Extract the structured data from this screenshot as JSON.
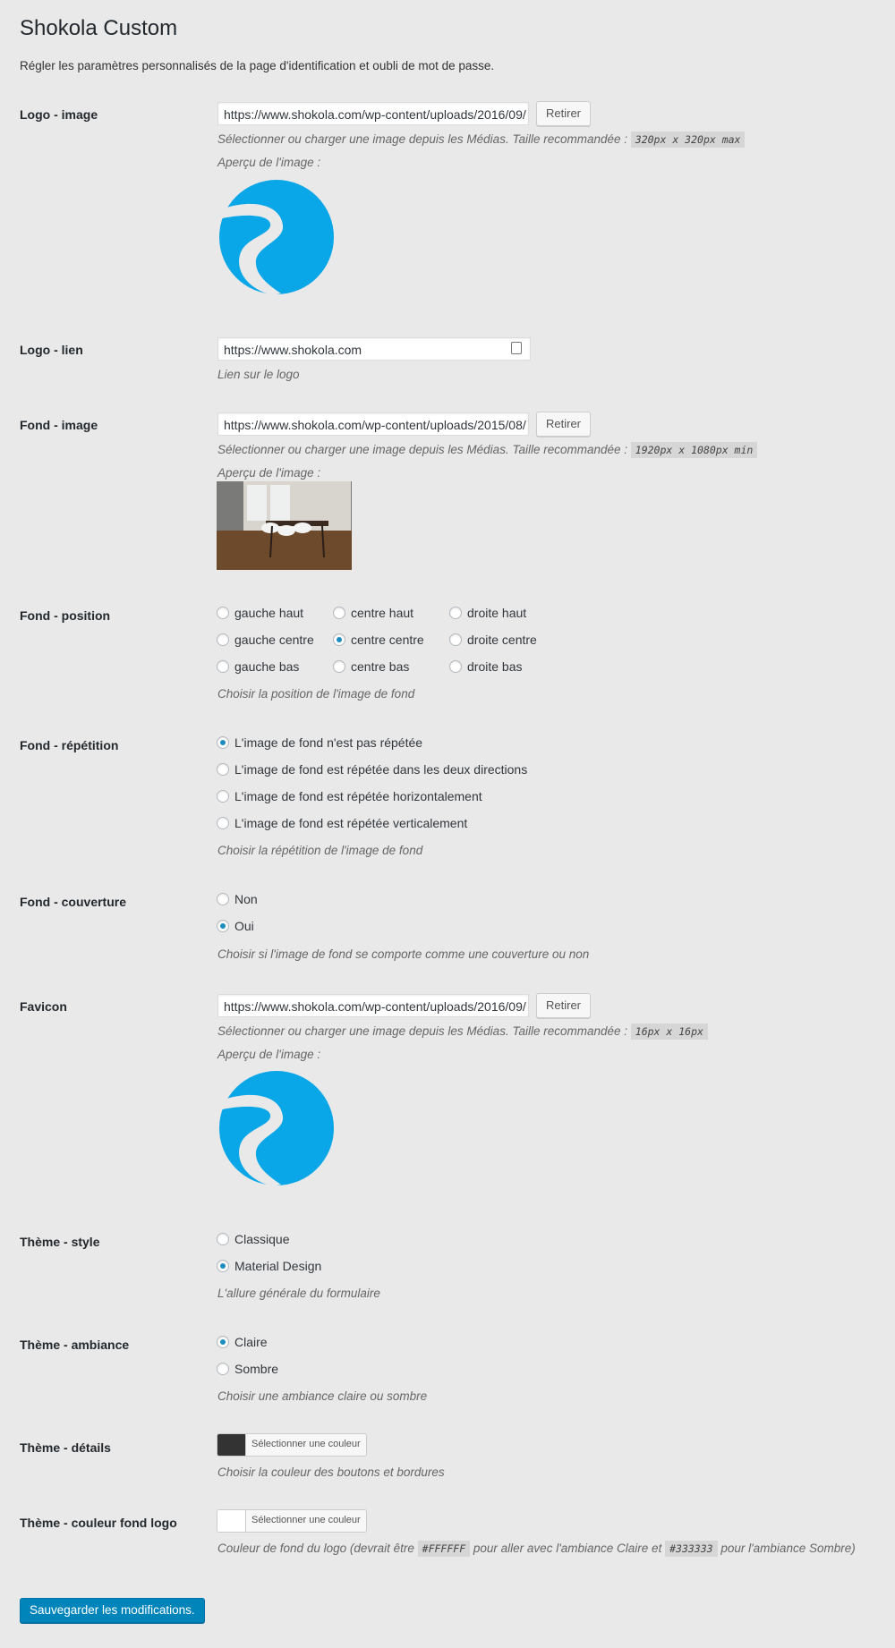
{
  "page": {
    "title": "Shokola Custom",
    "intro": "Régler les paramètres personnalisés de la page d'identification et oubli de mot de passe."
  },
  "preview_label": "Aperçu de l'image :",
  "remove_label": "Retirer",
  "media_desc": "Sélectionner ou charger une image depuis les Médias. Taille recommandée :",
  "logo_image": {
    "label": "Logo - image",
    "value": "https://www.shokola.com/wp-content/uploads/2016/09/",
    "size": "320px x 320px max"
  },
  "logo_link": {
    "label": "Logo - lien",
    "value": "https://www.shokola.com",
    "desc": "Lien sur le logo"
  },
  "bg_image": {
    "label": "Fond - image",
    "value": "https://www.shokola.com/wp-content/uploads/2015/08/",
    "size": "1920px x 1080px min"
  },
  "bg_position": {
    "label": "Fond - position",
    "options": [
      "gauche haut",
      "centre haut",
      "droite haut",
      "gauche centre",
      "centre centre",
      "droite centre",
      "gauche bas",
      "centre bas",
      "droite bas"
    ],
    "selected": "centre centre",
    "desc": "Choisir la position de l'image de fond"
  },
  "bg_repeat": {
    "label": "Fond - répétition",
    "options": [
      "L'image de fond n'est pas répétée",
      "L'image de fond est répétée dans les deux directions",
      "L'image de fond est répétée horizontalement",
      "L'image de fond est répétée verticalement"
    ],
    "selected": "L'image de fond n'est pas répétée",
    "desc": "Choisir la répétition de l'image de fond"
  },
  "bg_cover": {
    "label": "Fond - couverture",
    "options": [
      "Non",
      "Oui"
    ],
    "selected": "Oui",
    "desc": "Choisir si l'image de fond se comporte comme une couverture ou non"
  },
  "favicon": {
    "label": "Favicon",
    "value": "https://www.shokola.com/wp-content/uploads/2016/09/",
    "size": "16px x 16px"
  },
  "theme_style": {
    "label": "Thème - style",
    "options": [
      "Classique",
      "Material Design"
    ],
    "selected": "Material Design",
    "desc": "L'allure générale du formulaire"
  },
  "theme_mood": {
    "label": "Thème - ambiance",
    "options": [
      "Claire",
      "Sombre"
    ],
    "selected": "Claire",
    "desc": "Choisir une ambiance claire ou sombre"
  },
  "theme_details": {
    "label": "Thème - détails",
    "button": "Sélectionner une couleur",
    "color": "#333333",
    "desc": "Choisir la couleur des boutons et bordures"
  },
  "theme_logo_bg": {
    "label": "Thème - couleur fond logo",
    "button": "Sélectionner une couleur",
    "color": "#FFFFFF",
    "desc_a": "Couleur de fond du logo (devrait être",
    "code_a": "#FFFFFF",
    "desc_b": "pour aller avec l'ambiance Claire et",
    "code_b": "#333333",
    "desc_c": "pour l'ambiance Sombre)"
  },
  "save_label": "Sauvegarder les modifications.",
  "colors": {
    "accent": "#1e8cbe",
    "primary_button": "#0085ba",
    "logo_blue": "#0aa7e8"
  }
}
